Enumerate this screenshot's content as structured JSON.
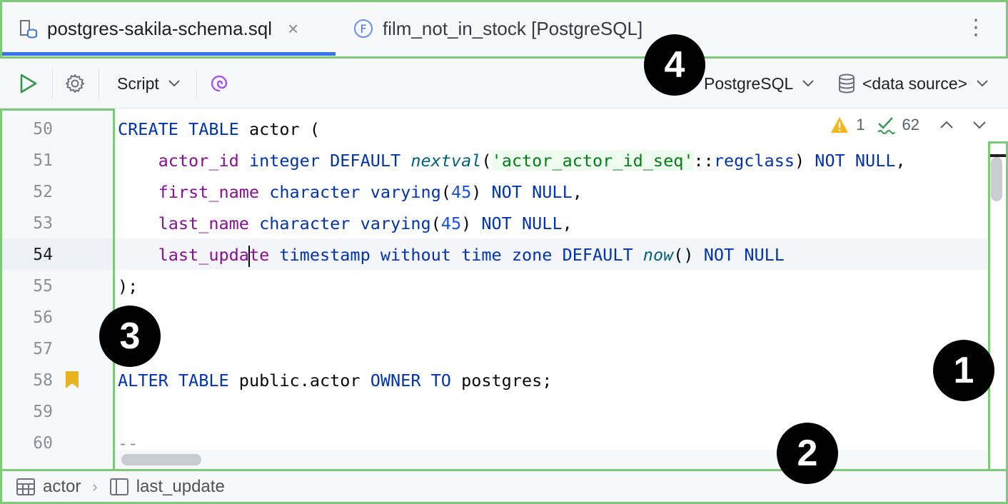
{
  "tabs": [
    {
      "label": "postgres-sakila-schema.sql",
      "icon": "sql-file-icon",
      "active": true,
      "close_glyph": "×"
    },
    {
      "label": "film_not_in_stock [PostgreSQL]",
      "icon": "function-icon",
      "icon_letter": "F",
      "active": false
    }
  ],
  "toolbar": {
    "script_label": "Script",
    "dialect_label": "PostgreSQL",
    "datasource_label": "<data source>"
  },
  "inspections": {
    "warnings": "1",
    "ok": "62"
  },
  "line_numbers": [
    "50",
    "51",
    "52",
    "53",
    "54",
    "55",
    "56",
    "57",
    "58",
    "59",
    "60"
  ],
  "current_line": "54",
  "code": {
    "l50": [
      "CREATE",
      " ",
      "TABLE",
      " actor ("
    ],
    "l51": [
      "    ",
      "actor_id",
      " ",
      "integer",
      " ",
      "DEFAULT",
      " ",
      "nextval",
      "(",
      "'actor_actor_id_seq'",
      "::",
      "regclass",
      ") ",
      "NOT",
      " ",
      "NULL",
      ","
    ],
    "l52": [
      "    ",
      "first_name",
      " ",
      "character",
      " ",
      "varying",
      "(",
      "45",
      ") ",
      "NOT",
      " ",
      "NULL",
      ","
    ],
    "l53": [
      "    ",
      "last_name",
      " ",
      "character",
      " ",
      "varying",
      "(",
      "45",
      ") ",
      "NOT",
      " ",
      "NULL",
      ","
    ],
    "l54": [
      "    ",
      "last_upda",
      "te",
      " ",
      "timestamp",
      " ",
      "without",
      " ",
      "time",
      " ",
      "zone",
      " ",
      "DEFAULT",
      " ",
      "now",
      "() ",
      "NOT",
      " ",
      "NULL"
    ],
    "l55": [
      ");"
    ],
    "l58": [
      "ALTER",
      " ",
      "TABLE",
      " public.actor ",
      "OWNER",
      " ",
      "TO",
      " postgres;"
    ],
    "l60": [
      "--"
    ]
  },
  "breadcrumb": {
    "table": "actor",
    "column": "last_update",
    "separator": "›"
  },
  "callouts": [
    "1",
    "2",
    "3",
    "4"
  ],
  "colors": {
    "keyword": "#0033b3",
    "column": "#871094",
    "function": "#00627a",
    "string": "#067d17",
    "number": "#1750eb",
    "outline": "#7cc97a",
    "active_tab_underline": "#3574f0"
  }
}
